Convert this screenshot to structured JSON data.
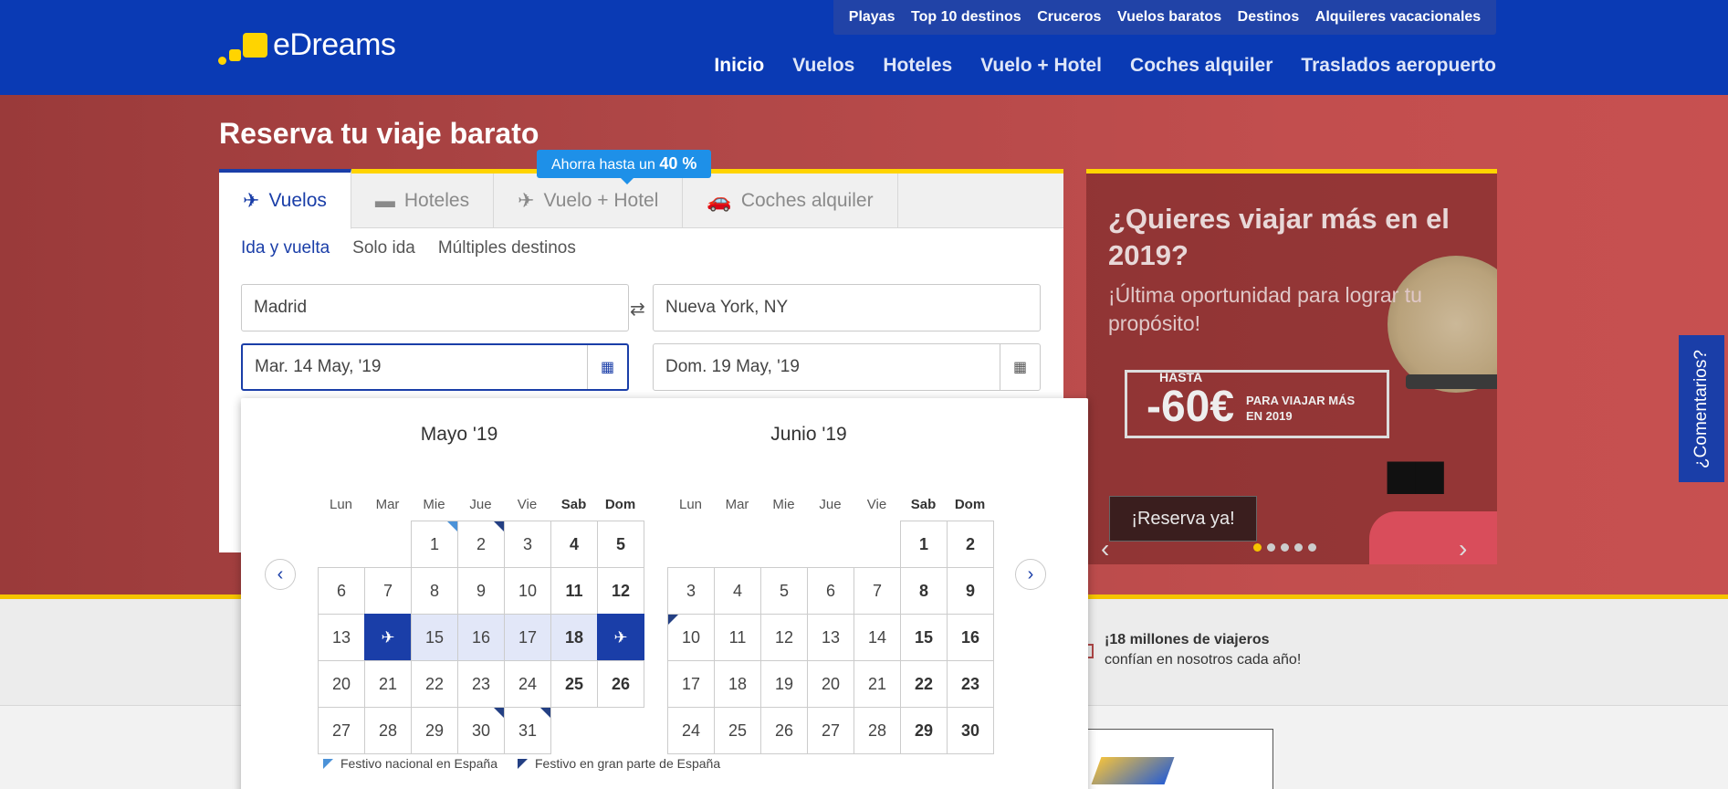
{
  "header": {
    "logo_text": "eDreams",
    "subnav": [
      "Playas",
      "Top 10 destinos",
      "Cruceros",
      "Vuelos baratos",
      "Destinos",
      "Alquileres vacacionales"
    ],
    "mainnav": [
      "Inicio",
      "Vuelos",
      "Hoteles",
      "Vuelo + Hotel",
      "Coches alquiler",
      "Traslados aeropuerto"
    ]
  },
  "hero": {
    "title": "Reserva tu viaje barato"
  },
  "search": {
    "tabs": [
      "Vuelos",
      "Hoteles",
      "Vuelo + Hotel",
      "Coches alquiler"
    ],
    "promo_text": "Ahorra hasta un",
    "promo_value": "40 %",
    "trip_types": [
      "Ida y vuelta",
      "Solo ida",
      "Múltiples destinos"
    ],
    "origin": "Madrid",
    "destination": "Nueva York, NY",
    "depart_date": "Mar. 14 May, '19",
    "return_date": "Dom. 19 May, '19"
  },
  "calendar": {
    "weekdays": [
      "Lun",
      "Mar",
      "Mie",
      "Jue",
      "Vie",
      "Sab",
      "Dom"
    ],
    "months": [
      {
        "title": "Mayo '19",
        "offset": 2,
        "days": 31
      },
      {
        "title": "Junio '19",
        "offset": 5,
        "days": 30
      }
    ],
    "legend_national": "Festivo nacional en España",
    "legend_regional": "Festivo en gran parte de España"
  },
  "side_promo": {
    "title": "¿Quieres viajar más en el 2019?",
    "text": "¡Última oportunidad para lograr tu propósito!",
    "badge_hasta": "HASTA",
    "badge_pct": "-60€",
    "badge_text": "PARA VIAJAR MÁS EN 2019",
    "cta": "¡Reserva ya!"
  },
  "feedback": "¿Comentarios?",
  "trust": {
    "title": "¡18 millones de viajeros",
    "text": "confían en nosotros cada año!"
  },
  "colors": {
    "brand_blue": "#0a3ab4",
    "accent_yellow": "#ffd400",
    "selected": "#1a3ea8"
  }
}
